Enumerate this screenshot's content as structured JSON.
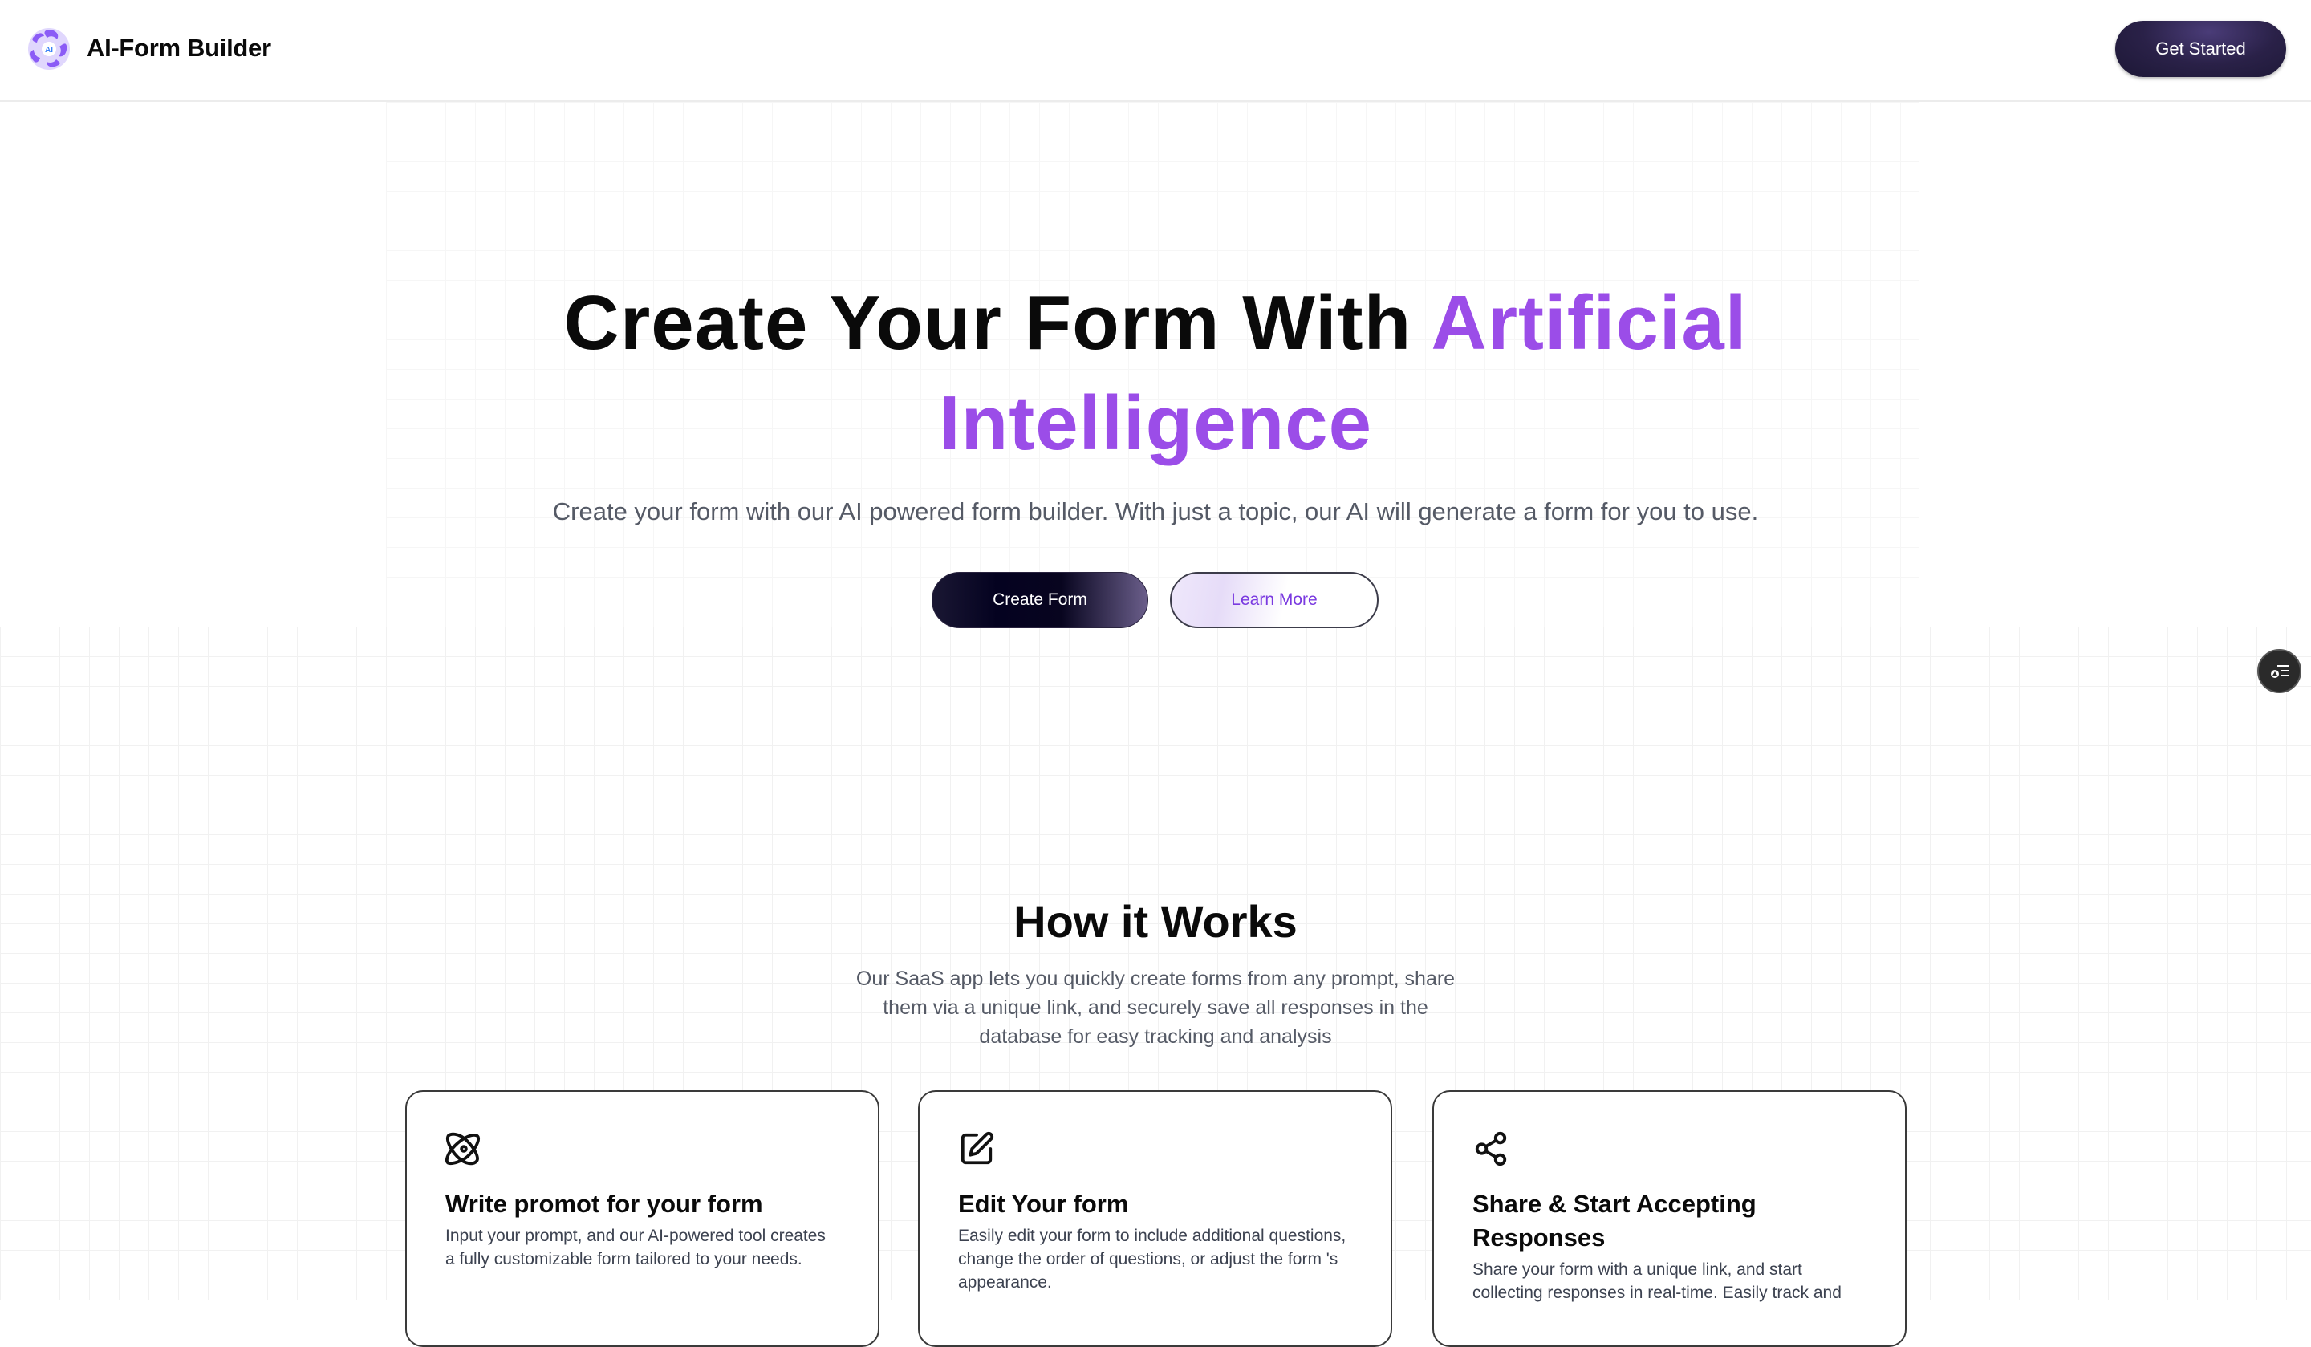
{
  "header": {
    "logo_text": "AI",
    "brand": "AI-Form Builder",
    "get_started": "Get Started"
  },
  "hero": {
    "title_plain": "Create Your Form With ",
    "title_accent_1": "Artificial",
    "title_accent_2": "Intelligence",
    "subtitle": "Create your form with our AI powered form builder. With just a topic, our AI will generate a form for you to use.",
    "create_button": "Create Form",
    "learn_button": "Learn More",
    "accent_color": "#9b4de8"
  },
  "how": {
    "title": "How it Works",
    "description": "Our SaaS app lets you quickly create forms from any prompt, share them via a unique link, and securely save all responses in the database for easy tracking and analysis",
    "cards": [
      {
        "icon": "atom-icon",
        "title": "Write promot for your form",
        "text": "Input your prompt, and our AI-powered tool creates a fully customizable form tailored to your needs."
      },
      {
        "icon": "edit-icon",
        "title": "Edit Your form",
        "text": "Easily edit your form to include additional questions, change the order of questions, or adjust the form 's appearance."
      },
      {
        "icon": "share-icon",
        "title": "Share & Start Accepting Responses",
        "text": "Share your form with a unique link, and start collecting responses in real-time. Easily track and"
      }
    ]
  }
}
